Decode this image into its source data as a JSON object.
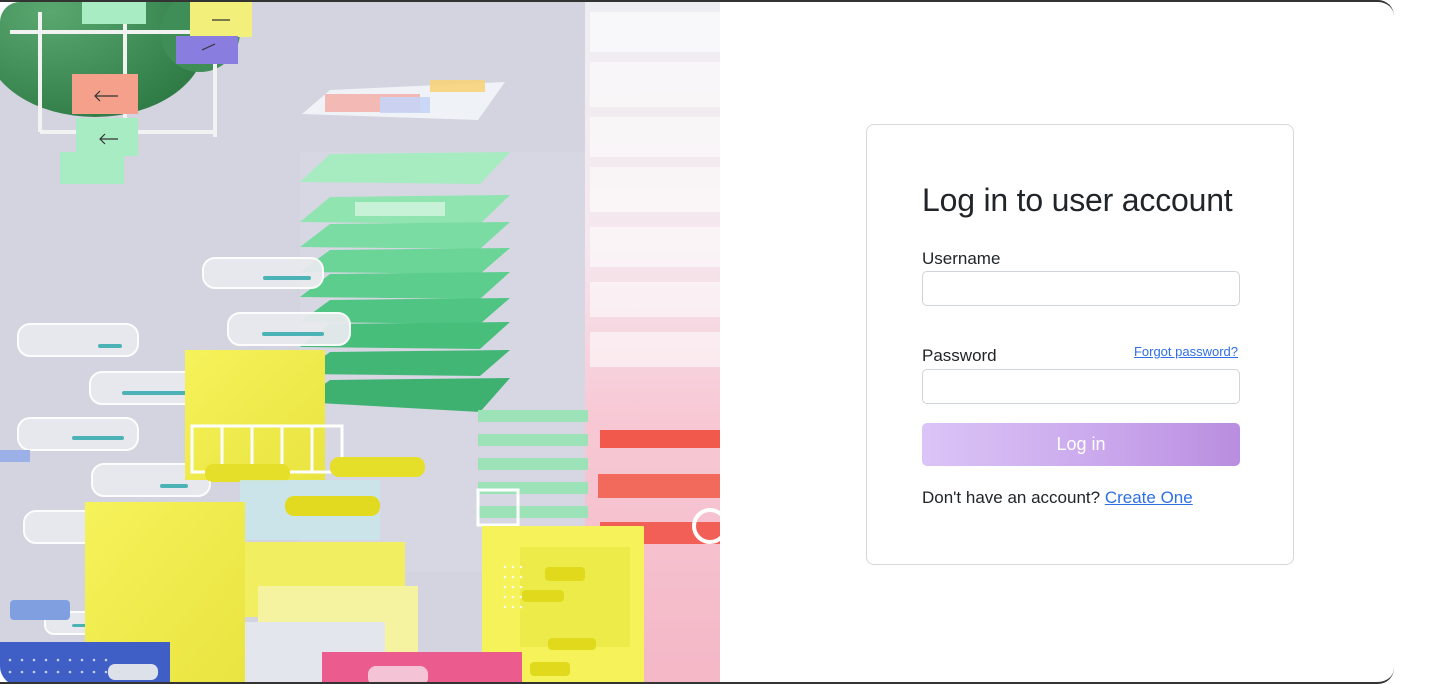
{
  "login": {
    "title": "Log in to user account",
    "username_label": "Username",
    "username_value": "",
    "password_label": "Password",
    "password_value": "",
    "forgot_link": "Forgot password?",
    "submit_label": "Log in",
    "signup_prompt": "Don't have an account?",
    "signup_link": "Create One"
  },
  "colors": {
    "accent_start": "#dbc4f6",
    "accent_end": "#b98ddf",
    "link": "#2f6fe4",
    "text": "#212529",
    "border": "#d5d7db"
  },
  "hero": {
    "image": "abstract-3d-illustration"
  }
}
